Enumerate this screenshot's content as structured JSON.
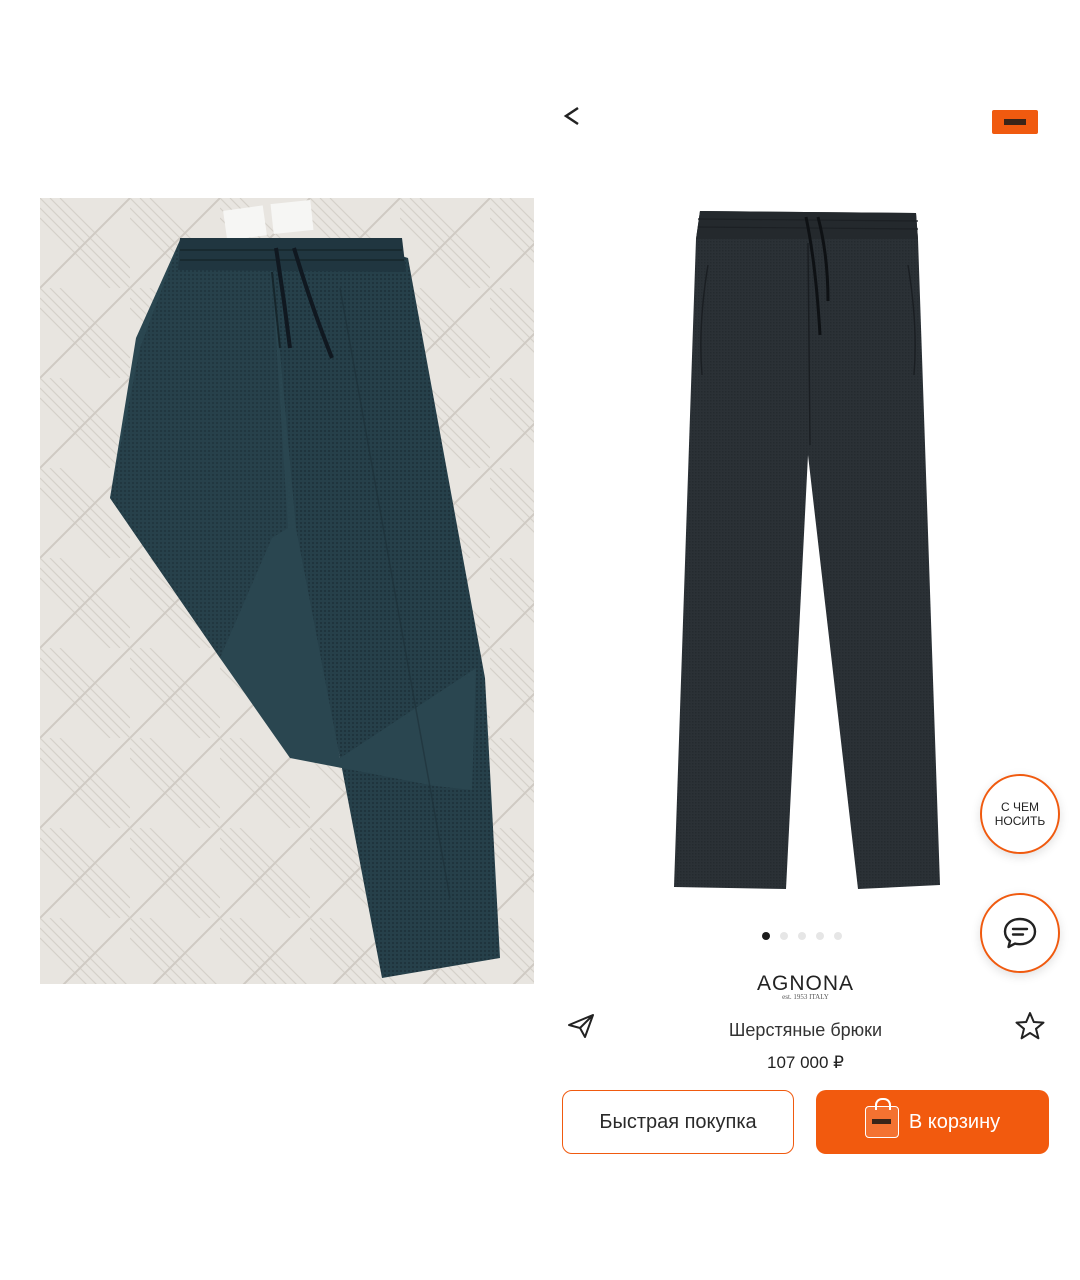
{
  "header": {
    "back_icon": "chevron-left-icon",
    "cart_badge_icon": "cart-badge-icon"
  },
  "gallery": {
    "dots_total": 5,
    "active_dot": 1
  },
  "product": {
    "brand": "AGNONA",
    "brand_sub": "est. 1953 ITALY",
    "title": "Шерстяные брюки",
    "price": "107 000 ₽"
  },
  "actions": {
    "quick_buy": "Быстрая покупка",
    "add_to_cart": "В корзину",
    "share_icon": "paper-plane-icon",
    "favorite_icon": "star-outline-icon",
    "cart_icon": "shopping-bag-icon"
  },
  "floating": {
    "what_to_wear_line1": "С ЧЕМ",
    "what_to_wear_line2": "НОСИТЬ",
    "chat_icon": "chat-bubble-icon"
  },
  "colors": {
    "accent": "#f25a0e",
    "pants_photo": "#263c44",
    "pants_product": "#2a3036"
  }
}
